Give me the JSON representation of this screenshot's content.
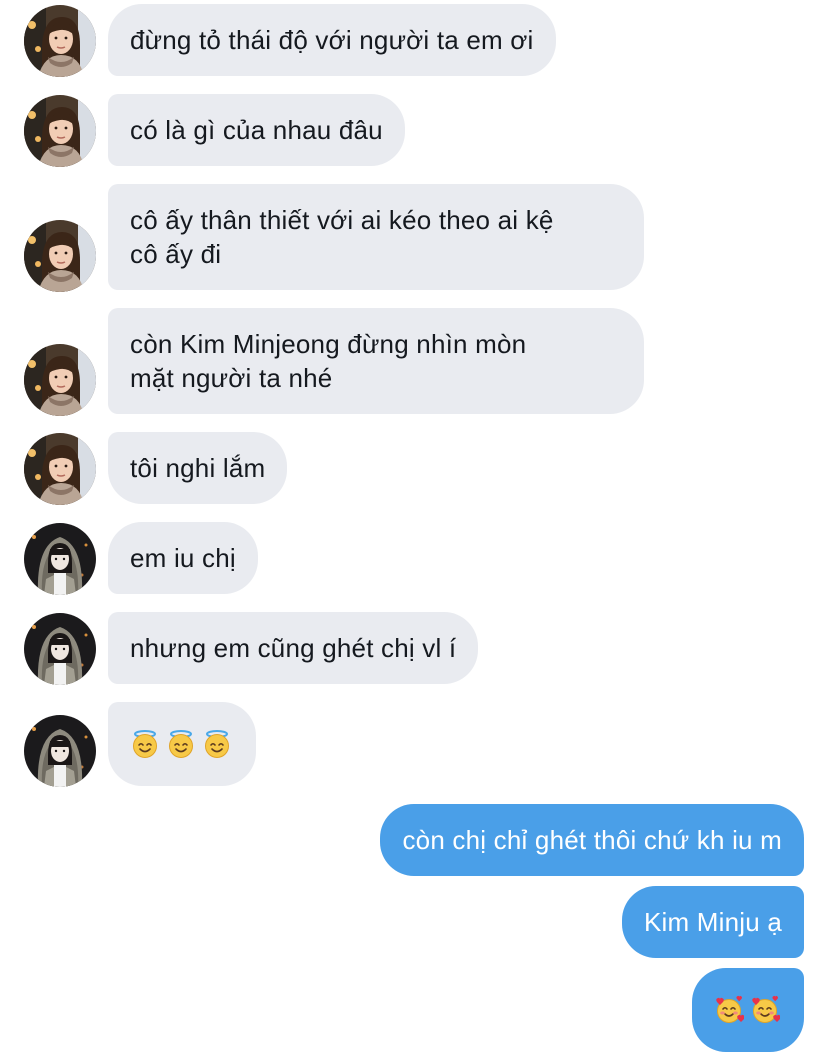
{
  "thread": {
    "incoming_avatar_a": "brown-hair-avatar",
    "incoming_avatar_b": "hooded-jacket-avatar",
    "colors": {
      "incoming_bubble": "#e9ebf0",
      "outgoing_bubble": "#4a9fe8",
      "incoming_text": "#15191f",
      "outgoing_text": "#ffffff"
    },
    "messages": [
      {
        "sender": "other_a",
        "text": "đừng tỏ thái độ với người ta em ơi"
      },
      {
        "sender": "other_a",
        "text": "có là gì của nhau đâu"
      },
      {
        "sender": "other_a",
        "line1": "cô ấy thân thiết với ai kéo theo ai kệ",
        "line2": "cô ấy đi"
      },
      {
        "sender": "other_a",
        "line1": "còn Kim Minjeong đừng nhìn mòn",
        "line2": "mặt người ta nhé"
      },
      {
        "sender": "other_a",
        "text": "tôi nghi lắm"
      },
      {
        "sender": "other_b",
        "text": "em iu chị"
      },
      {
        "sender": "other_b",
        "text": "nhưng em cũng ghét chị vl í"
      },
      {
        "sender": "other_b",
        "emoji": [
          "smiling-face-with-halo",
          "smiling-face-with-halo",
          "smiling-face-with-halo"
        ]
      },
      {
        "sender": "me",
        "text": "còn chị chỉ ghét thôi chứ kh iu m"
      },
      {
        "sender": "me",
        "text": "Kim Minju ạ"
      },
      {
        "sender": "me",
        "emoji": [
          "smiling-face-with-hearts",
          "smiling-face-with-hearts"
        ]
      }
    ]
  }
}
